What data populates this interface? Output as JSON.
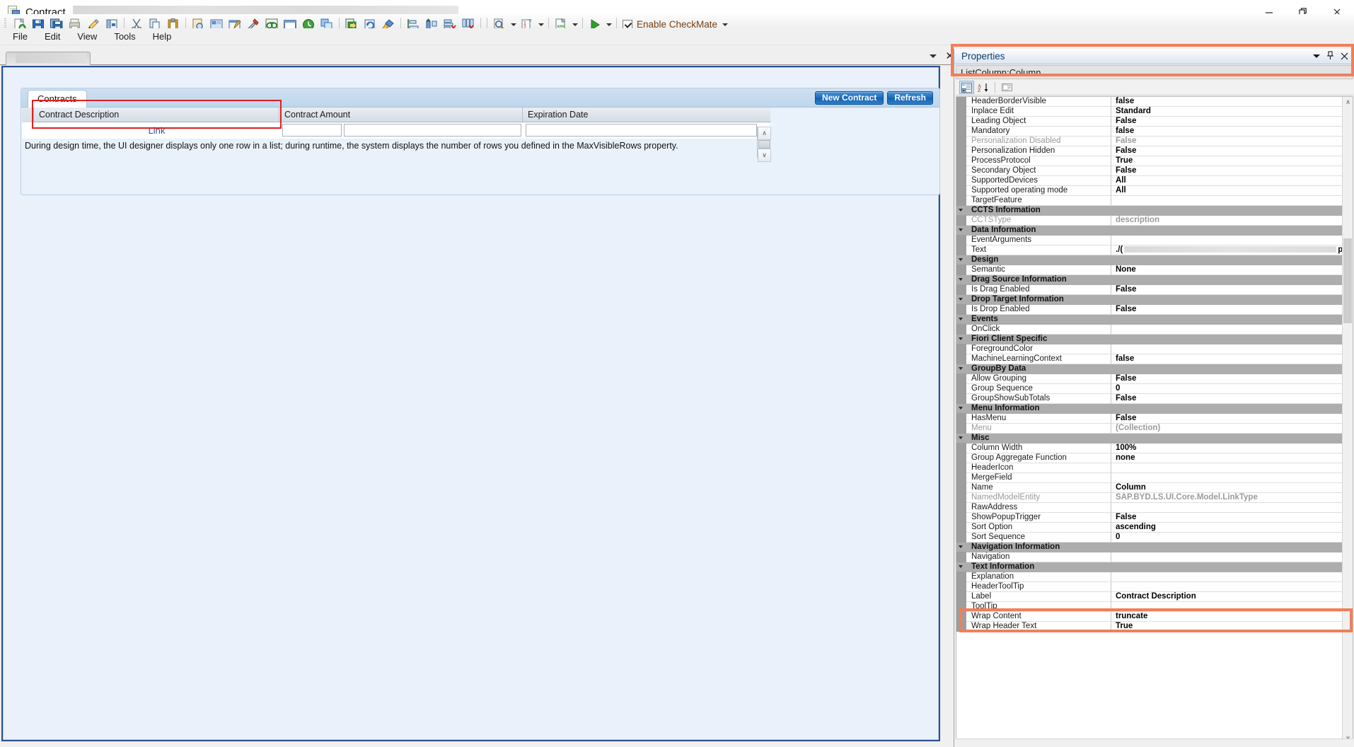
{
  "window": {
    "title": "Contract_",
    "minimize_label": "─",
    "maximize_label": "❐",
    "close_label": "✕"
  },
  "menu": {
    "items": [
      "File",
      "Edit",
      "View",
      "Tools",
      "Help"
    ]
  },
  "toolbar": {
    "checkmate_label": "Enable CheckMate",
    "icons": [
      "new-document-icon",
      "save-icon",
      "save-all-icon",
      "print-icon",
      "edit-icon",
      "properties-icon",
      "cut-icon",
      "copy-icon",
      "paste-icon",
      "find-icon",
      "layout-icon",
      "annotate-icon",
      "tools-icon",
      "search-binoculars-icon",
      "window-icon",
      "history-icon",
      "components-icon",
      "export-icon",
      "refresh-icon",
      "clean-icon",
      "align-left-icon",
      "align-top-icon",
      "delete-row-icon",
      "delete-column-icon",
      "preview-icon",
      "numbering-icon",
      "xml-icon",
      "run-icon"
    ]
  },
  "doc_tab": {
    "redacted": true
  },
  "designer": {
    "tab_label": "Contracts",
    "buttons": {
      "new_contract": "New Contract",
      "refresh": "Refresh"
    },
    "columns": [
      {
        "header": "Contract Description",
        "cell": "Link"
      },
      {
        "header": "Contract Amount",
        "cell": ""
      },
      {
        "header": "Expiration Date",
        "cell": ""
      }
    ],
    "hint": "During design time, the UI designer displays only one row in a list; during runtime, the system displays the number of rows you defined in the MaxVisibleRows property.",
    "scroll_up": "∧",
    "scroll_down": "∨"
  },
  "properties": {
    "title": "Properties",
    "object": "ListColumn:Column",
    "caret_label": "▼",
    "pin_label": "⤓",
    "close_label": "✕",
    "toolbar": {
      "categorized": "categorized-view-icon",
      "alphabetical": "alphabetical-sort-icon",
      "property_pages": "property-pages-icon"
    },
    "scroll_up": "∧",
    "scroll_down": "∨",
    "rows": [
      {
        "type": "prop",
        "name": "HeaderBorderVisible",
        "value": "false"
      },
      {
        "type": "prop",
        "name": "Inplace Edit",
        "value": "Standard"
      },
      {
        "type": "prop",
        "name": "Leading Object",
        "value": "False"
      },
      {
        "type": "prop",
        "name": "Mandatory",
        "value": "false"
      },
      {
        "type": "prop",
        "name": "Personalization Disabled",
        "value": "False",
        "dim": true
      },
      {
        "type": "prop",
        "name": "Personalization Hidden",
        "value": "False"
      },
      {
        "type": "prop",
        "name": "ProcessProtocol",
        "value": "True"
      },
      {
        "type": "prop",
        "name": "Secondary Object",
        "value": "False"
      },
      {
        "type": "prop",
        "name": "SupportedDevices",
        "value": "All"
      },
      {
        "type": "prop",
        "name": "Supported operating mode",
        "value": "All"
      },
      {
        "type": "prop",
        "name": "TargetFeature",
        "value": ""
      },
      {
        "type": "cat",
        "name": "CCTS Information",
        "value": ""
      },
      {
        "type": "prop",
        "name": "CCTSType",
        "value": "description",
        "dim": true
      },
      {
        "type": "cat",
        "name": "Data Information",
        "value": ""
      },
      {
        "type": "prop",
        "name": "EventArguments",
        "value": ""
      },
      {
        "type": "prop",
        "name": "Text",
        "value": "./(",
        "redacted": true,
        "suffix": "p"
      },
      {
        "type": "cat",
        "name": "Design",
        "value": ""
      },
      {
        "type": "prop",
        "name": "Semantic",
        "value": "None"
      },
      {
        "type": "cat",
        "name": "Drag Source Information",
        "value": ""
      },
      {
        "type": "prop",
        "name": "Is Drag Enabled",
        "value": "False"
      },
      {
        "type": "cat",
        "name": "Drop Target Information",
        "value": ""
      },
      {
        "type": "prop",
        "name": "Is Drop Enabled",
        "value": "False"
      },
      {
        "type": "cat",
        "name": "Events",
        "value": ""
      },
      {
        "type": "prop",
        "name": "OnClick",
        "value": ""
      },
      {
        "type": "cat",
        "name": "Fiori Client Specific",
        "value": ""
      },
      {
        "type": "prop",
        "name": "ForegroundColor",
        "value": ""
      },
      {
        "type": "prop",
        "name": "MachineLearningContext",
        "value": "false"
      },
      {
        "type": "cat",
        "name": "GroupBy Data",
        "value": ""
      },
      {
        "type": "prop",
        "name": "Allow Grouping",
        "value": "False"
      },
      {
        "type": "prop",
        "name": "Group Sequence",
        "value": "0"
      },
      {
        "type": "prop",
        "name": "GroupShowSubTotals",
        "value": "False"
      },
      {
        "type": "cat",
        "name": "Menu Information",
        "value": ""
      },
      {
        "type": "prop",
        "name": "HasMenu",
        "value": "False"
      },
      {
        "type": "prop",
        "name": "Menu",
        "value": "(Collection)",
        "dim": true
      },
      {
        "type": "cat",
        "name": "Misc",
        "value": ""
      },
      {
        "type": "prop",
        "name": "Column Width",
        "value": "100%"
      },
      {
        "type": "prop",
        "name": "Group Aggregate Function",
        "value": "none"
      },
      {
        "type": "prop",
        "name": "HeaderIcon",
        "value": ""
      },
      {
        "type": "prop",
        "name": "MergeField",
        "value": ""
      },
      {
        "type": "prop",
        "name": "Name",
        "value": "Column"
      },
      {
        "type": "prop",
        "name": "NamedModelEntity",
        "value": "SAP.BYD.LS.UI.Core.Model.LinkType",
        "dim": true
      },
      {
        "type": "prop",
        "name": "RawAddress",
        "value": ""
      },
      {
        "type": "prop",
        "name": "ShowPopupTrigger",
        "value": "False"
      },
      {
        "type": "prop",
        "name": "Sort Option",
        "value": "ascending",
        "highlighted": true
      },
      {
        "type": "prop",
        "name": "Sort Sequence",
        "value": "0"
      },
      {
        "type": "cat",
        "name": "Navigation Information",
        "value": ""
      },
      {
        "type": "prop",
        "name": "Navigation",
        "value": ""
      },
      {
        "type": "cat",
        "name": "Text Information",
        "value": ""
      },
      {
        "type": "prop",
        "name": "Explanation",
        "value": ""
      },
      {
        "type": "prop",
        "name": "HeaderToolTip",
        "value": ""
      },
      {
        "type": "prop",
        "name": "Label",
        "value": "Contract Description"
      },
      {
        "type": "prop",
        "name": "ToolTip",
        "value": ""
      },
      {
        "type": "prop",
        "name": "Wrap Content",
        "value": "truncate"
      },
      {
        "type": "prop",
        "name": "Wrap Header Text",
        "value": "True"
      }
    ]
  },
  "annotations": {
    "highlight_color": "#f07f5a",
    "red_box_color": "#e02020"
  }
}
